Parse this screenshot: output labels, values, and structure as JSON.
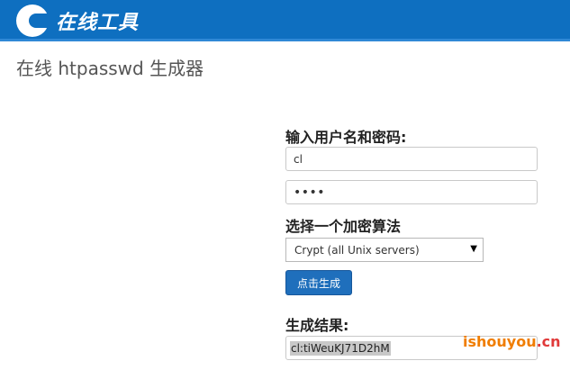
{
  "header": {
    "logo_text": "在线工具",
    "brand_color": "#0e6fc0"
  },
  "page": {
    "title": "在线 htpasswd 生成器"
  },
  "form": {
    "credentials_label": "输入用户名和密码:",
    "username_value": "cl",
    "password_mask": "••••",
    "algorithm_label": "选择一个加密算法",
    "algorithm_selected": "Crypt (all Unix servers)",
    "generate_button": "点击生成",
    "result_label": "生成结果:",
    "result_value": "cl:tiWeuKJ71D2hM"
  },
  "watermark": {
    "domain": "ishouyou",
    "suffix": ".cn"
  }
}
